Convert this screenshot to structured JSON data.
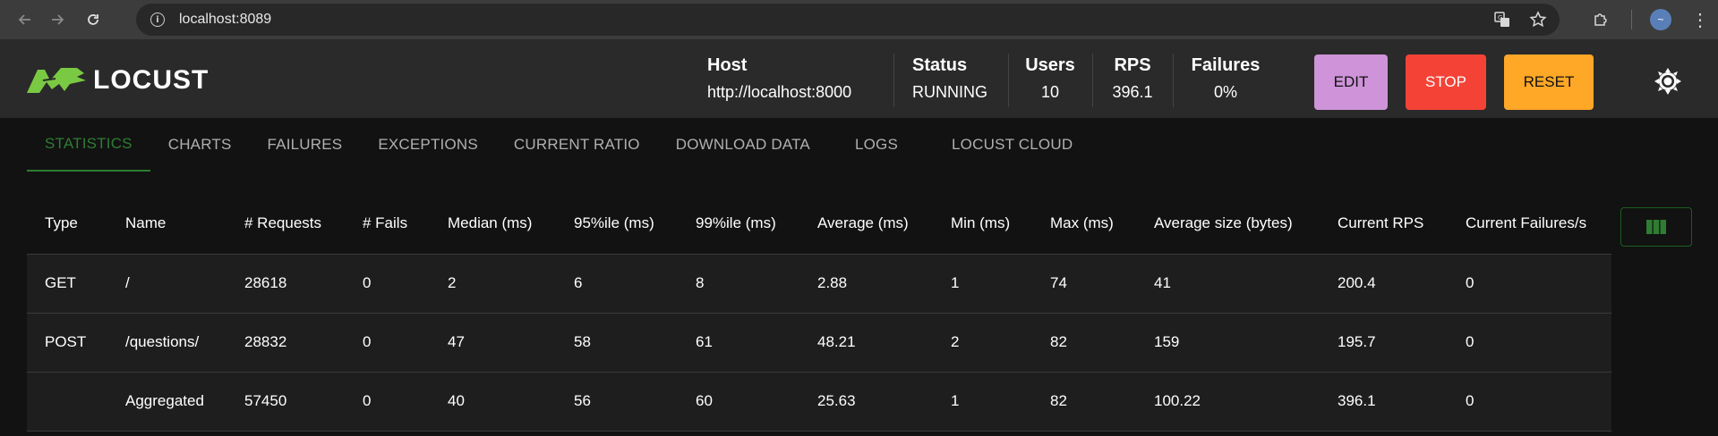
{
  "browser": {
    "url": "localhost:8089"
  },
  "header": {
    "logo_text": "LOCUST",
    "brand_color": "#7ac943",
    "stats": [
      {
        "label": "Host",
        "value": "http://localhost:8000"
      },
      {
        "label": "Status",
        "value": "RUNNING"
      },
      {
        "label": "Users",
        "value": "10"
      },
      {
        "label": "RPS",
        "value": "396.1"
      },
      {
        "label": "Failures",
        "value": "0%"
      }
    ],
    "buttons": {
      "edit": "EDIT",
      "stop": "STOP",
      "reset": "RESET"
    },
    "button_colors": {
      "edit": "#ce93d8",
      "stop": "#f44336",
      "reset": "#ffa726"
    }
  },
  "tabs": [
    {
      "label": "STATISTICS",
      "active": true
    },
    {
      "label": "CHARTS",
      "active": false
    },
    {
      "label": "FAILURES",
      "active": false
    },
    {
      "label": "EXCEPTIONS",
      "active": false
    },
    {
      "label": "CURRENT RATIO",
      "active": false
    },
    {
      "label": "DOWNLOAD DATA",
      "active": false
    },
    {
      "label": "LOGS",
      "active": false
    },
    {
      "label": "LOCUST CLOUD",
      "active": false
    }
  ],
  "table": {
    "columns": [
      "Type",
      "Name",
      "# Requests",
      "# Fails",
      "Median (ms)",
      "95%ile (ms)",
      "99%ile (ms)",
      "Average (ms)",
      "Min (ms)",
      "Max (ms)",
      "Average size (bytes)",
      "Current RPS",
      "Current Failures/s"
    ],
    "rows": [
      [
        "GET",
        "/",
        "28618",
        "0",
        "2",
        "6",
        "8",
        "2.88",
        "1",
        "74",
        "41",
        "200.4",
        "0"
      ],
      [
        "POST",
        "/questions/",
        "28832",
        "0",
        "47",
        "58",
        "61",
        "48.21",
        "2",
        "82",
        "159",
        "195.7",
        "0"
      ],
      [
        "",
        "Aggregated",
        "57450",
        "0",
        "40",
        "56",
        "60",
        "25.63",
        "1",
        "82",
        "100.22",
        "396.1",
        "0"
      ]
    ]
  },
  "icons": {
    "back": "arrow-left-icon",
    "forward": "arrow-right-icon",
    "reload": "reload-icon",
    "site_info": "info-icon",
    "translate": "translate-icon",
    "bookmark": "star-icon",
    "extensions": "puzzle-icon",
    "menu": "kebab-menu-icon",
    "theme": "brightness-icon",
    "columns": "view-column-icon"
  }
}
